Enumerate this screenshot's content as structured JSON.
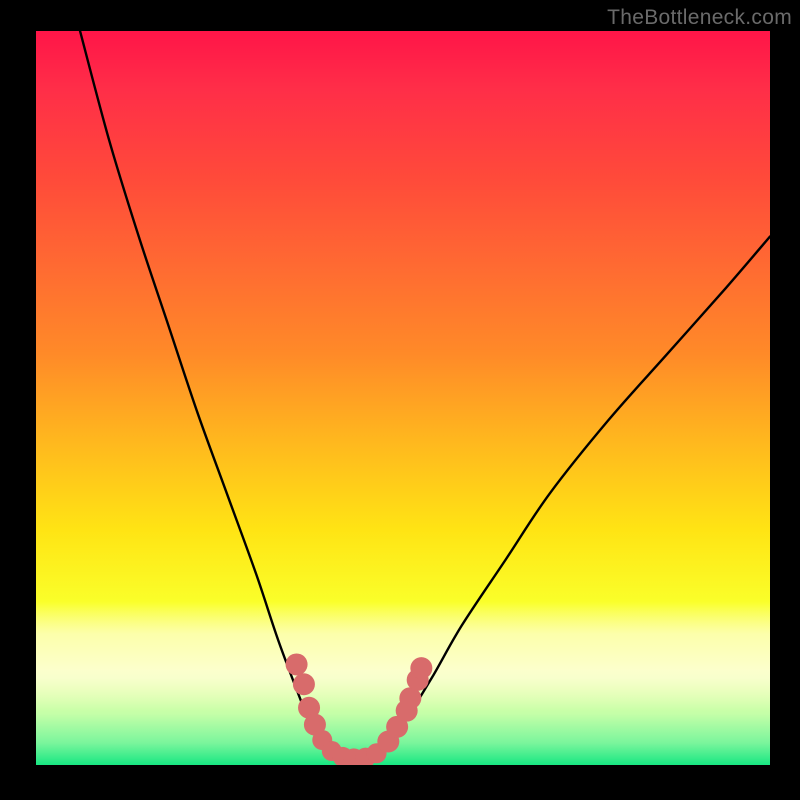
{
  "watermark": "TheBottleneck.com",
  "chart_data": {
    "type": "line",
    "title": "",
    "xlabel": "",
    "ylabel": "",
    "xlim": [
      0,
      100
    ],
    "ylim": [
      0,
      100
    ],
    "grid": false,
    "legend": false,
    "series": [
      {
        "name": "bottleneck-curve",
        "color": "#000000",
        "points": [
          {
            "x": 6,
            "y": 100
          },
          {
            "x": 10,
            "y": 85
          },
          {
            "x": 14,
            "y": 72
          },
          {
            "x": 18,
            "y": 60
          },
          {
            "x": 22,
            "y": 48
          },
          {
            "x": 26,
            "y": 37
          },
          {
            "x": 30,
            "y": 26
          },
          {
            "x": 33,
            "y": 17
          },
          {
            "x": 36,
            "y": 9
          },
          {
            "x": 38,
            "y": 4
          },
          {
            "x": 40,
            "y": 1.5
          },
          {
            "x": 42,
            "y": 0.8
          },
          {
            "x": 44,
            "y": 0.7
          },
          {
            "x": 46,
            "y": 1.0
          },
          {
            "x": 48,
            "y": 2.6
          },
          {
            "x": 50,
            "y": 5.5
          },
          {
            "x": 54,
            "y": 12
          },
          {
            "x": 58,
            "y": 19
          },
          {
            "x": 64,
            "y": 28
          },
          {
            "x": 70,
            "y": 37
          },
          {
            "x": 78,
            "y": 47
          },
          {
            "x": 86,
            "y": 56
          },
          {
            "x": 94,
            "y": 65
          },
          {
            "x": 100,
            "y": 72
          }
        ]
      }
    ],
    "markers": [
      {
        "name": "emphasis-dot",
        "color": "#d86b6b",
        "r": 11,
        "x": 35.5,
        "y": 13.7
      },
      {
        "name": "emphasis-dot",
        "color": "#d86b6b",
        "r": 11,
        "x": 36.5,
        "y": 11.0
      },
      {
        "name": "emphasis-dot",
        "color": "#d86b6b",
        "r": 11,
        "x": 37.2,
        "y": 7.8
      },
      {
        "name": "emphasis-dot",
        "color": "#d86b6b",
        "r": 11,
        "x": 38.0,
        "y": 5.5
      },
      {
        "name": "emphasis-dot",
        "color": "#d86b6b",
        "r": 10,
        "x": 39.0,
        "y": 3.4
      },
      {
        "name": "emphasis-dot",
        "color": "#d86b6b",
        "r": 10,
        "x": 40.3,
        "y": 1.9
      },
      {
        "name": "emphasis-dot",
        "color": "#d86b6b",
        "r": 10,
        "x": 41.8,
        "y": 1.1
      },
      {
        "name": "emphasis-dot",
        "color": "#d86b6b",
        "r": 10,
        "x": 43.3,
        "y": 0.9
      },
      {
        "name": "emphasis-dot",
        "color": "#d86b6b",
        "r": 10,
        "x": 44.9,
        "y": 1.0
      },
      {
        "name": "emphasis-dot",
        "color": "#d86b6b",
        "r": 10,
        "x": 46.4,
        "y": 1.6
      },
      {
        "name": "emphasis-dot",
        "color": "#d86b6b",
        "r": 11,
        "x": 48.0,
        "y": 3.2
      },
      {
        "name": "emphasis-dot",
        "color": "#d86b6b",
        "r": 11,
        "x": 49.2,
        "y": 5.2
      },
      {
        "name": "emphasis-dot",
        "color": "#d86b6b",
        "r": 11,
        "x": 50.5,
        "y": 7.4
      },
      {
        "name": "emphasis-dot",
        "color": "#d86b6b",
        "r": 11,
        "x": 51.0,
        "y": 9.1
      },
      {
        "name": "emphasis-dot",
        "color": "#d86b6b",
        "r": 11,
        "x": 52.0,
        "y": 11.6
      },
      {
        "name": "emphasis-dot",
        "color": "#d86b6b",
        "r": 11,
        "x": 52.5,
        "y": 13.2
      }
    ],
    "background": {
      "type": "gradient",
      "direction": "vertical",
      "stops": [
        {
          "pos": 0.0,
          "color": "#ff1548"
        },
        {
          "pos": 0.2,
          "color": "#ff4a3a"
        },
        {
          "pos": 0.44,
          "color": "#ff8a28"
        },
        {
          "pos": 0.68,
          "color": "#ffe414"
        },
        {
          "pos": 0.87,
          "color": "#f8ffa6"
        },
        {
          "pos": 0.97,
          "color": "#7af59c"
        },
        {
          "pos": 1.0,
          "color": "#18e782"
        }
      ]
    }
  }
}
